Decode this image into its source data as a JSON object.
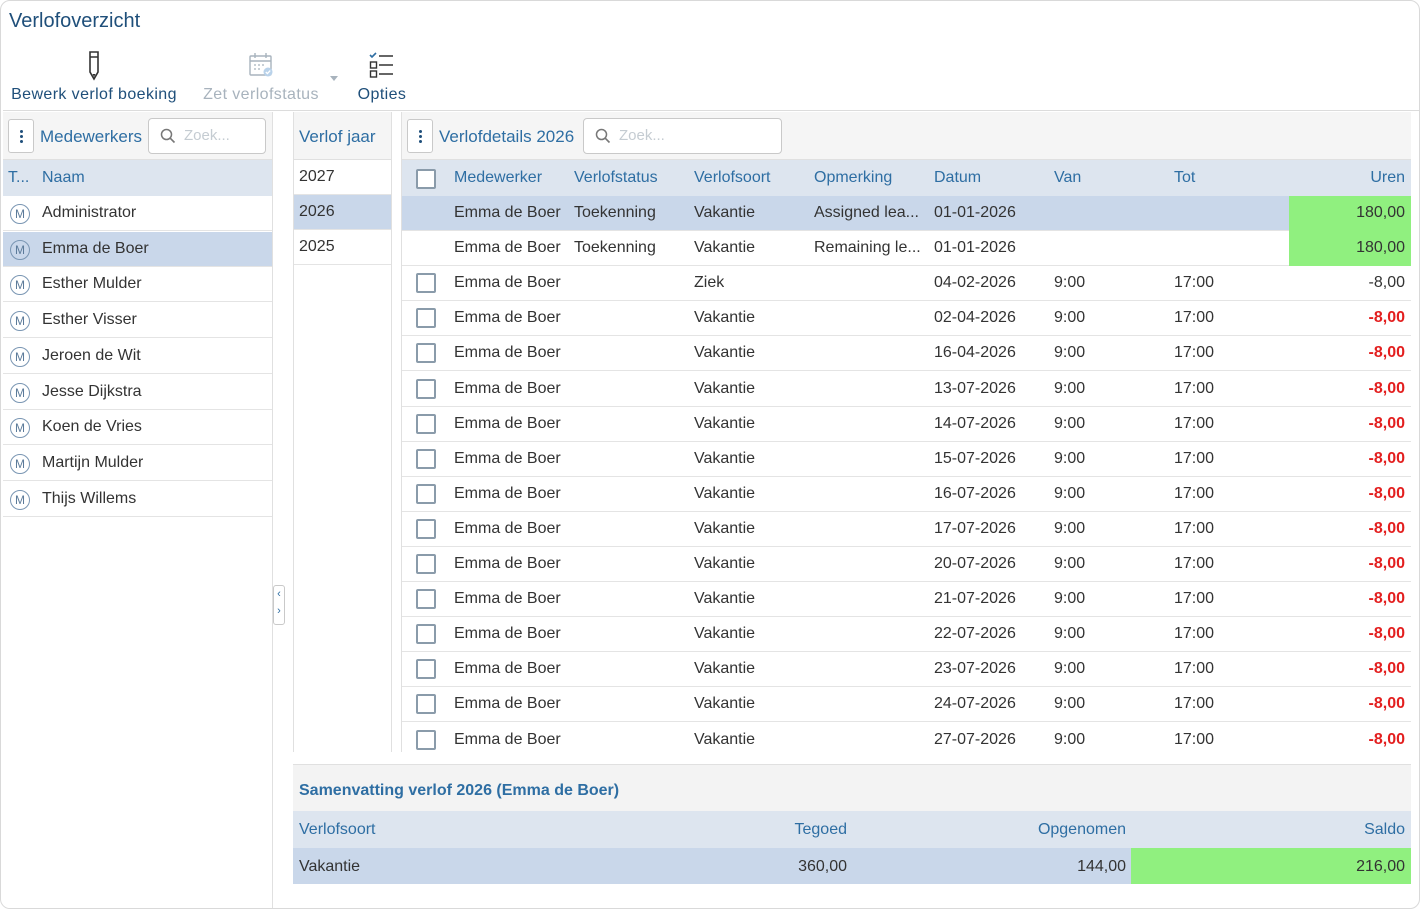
{
  "app": {
    "title": "Verlofoverzicht"
  },
  "toolbar": {
    "edit_label": "Bewerk verlof boeking",
    "status_label": "Zet verlofstatus",
    "options_label": "Opties"
  },
  "employees": {
    "title": "Medewerkers",
    "search_placeholder": "Zoek...",
    "col_type": "T...",
    "col_name": "Naam",
    "badge": "M",
    "items": [
      {
        "name": "Administrator"
      },
      {
        "name": "Emma de Boer",
        "selected": true
      },
      {
        "name": "Esther Mulder"
      },
      {
        "name": "Esther Visser"
      },
      {
        "name": "Jeroen de Wit"
      },
      {
        "name": "Jesse Dijkstra"
      },
      {
        "name": "Koen de Vries"
      },
      {
        "name": "Martijn Mulder"
      },
      {
        "name": "Thijs Willems"
      }
    ]
  },
  "years": {
    "title": "Verlof jaar",
    "items": [
      {
        "year": "2027"
      },
      {
        "year": "2026",
        "selected": true
      },
      {
        "year": "2025"
      }
    ]
  },
  "details": {
    "title": "Verlofdetails 2026",
    "search_placeholder": "Zoek...",
    "columns": {
      "medewerker": "Medewerker",
      "status": "Verlofstatus",
      "soort": "Verlofsoort",
      "opmerking": "Opmerking",
      "datum": "Datum",
      "van": "Van",
      "tot": "Tot",
      "uren": "Uren"
    },
    "rows": [
      {
        "medewerker": "Emma de Boer",
        "status": "Toekenning",
        "soort": "Vakantie",
        "opmerking": "Assigned lea...",
        "datum": "01-01-2026",
        "van": "",
        "tot": "",
        "uren": "180,00",
        "selected": true,
        "checkbox": false,
        "highlight": "green"
      },
      {
        "medewerker": "Emma de Boer",
        "status": "Toekenning",
        "soort": "Vakantie",
        "opmerking": "Remaining le...",
        "datum": "01-01-2026",
        "van": "",
        "tot": "",
        "uren": "180,00",
        "checkbox": false,
        "highlight": "green"
      },
      {
        "medewerker": "Emma de Boer",
        "status": "",
        "soort": "Ziek",
        "opmerking": "",
        "datum": "04-02-2026",
        "van": "9:00",
        "tot": "17:00",
        "uren": "-8,00",
        "checkbox": true,
        "highlight": "none"
      },
      {
        "medewerker": "Emma de Boer",
        "status": "",
        "soort": "Vakantie",
        "opmerking": "",
        "datum": "02-04-2026",
        "van": "9:00",
        "tot": "17:00",
        "uren": "-8,00",
        "checkbox": true,
        "highlight": "red"
      },
      {
        "medewerker": "Emma de Boer",
        "status": "",
        "soort": "Vakantie",
        "opmerking": "",
        "datum": "16-04-2026",
        "van": "9:00",
        "tot": "17:00",
        "uren": "-8,00",
        "checkbox": true,
        "highlight": "red"
      },
      {
        "medewerker": "Emma de Boer",
        "status": "",
        "soort": "Vakantie",
        "opmerking": "",
        "datum": "13-07-2026",
        "van": "9:00",
        "tot": "17:00",
        "uren": "-8,00",
        "checkbox": true,
        "highlight": "red"
      },
      {
        "medewerker": "Emma de Boer",
        "status": "",
        "soort": "Vakantie",
        "opmerking": "",
        "datum": "14-07-2026",
        "van": "9:00",
        "tot": "17:00",
        "uren": "-8,00",
        "checkbox": true,
        "highlight": "red"
      },
      {
        "medewerker": "Emma de Boer",
        "status": "",
        "soort": "Vakantie",
        "opmerking": "",
        "datum": "15-07-2026",
        "van": "9:00",
        "tot": "17:00",
        "uren": "-8,00",
        "checkbox": true,
        "highlight": "red"
      },
      {
        "medewerker": "Emma de Boer",
        "status": "",
        "soort": "Vakantie",
        "opmerking": "",
        "datum": "16-07-2026",
        "van": "9:00",
        "tot": "17:00",
        "uren": "-8,00",
        "checkbox": true,
        "highlight": "red"
      },
      {
        "medewerker": "Emma de Boer",
        "status": "",
        "soort": "Vakantie",
        "opmerking": "",
        "datum": "17-07-2026",
        "van": "9:00",
        "tot": "17:00",
        "uren": "-8,00",
        "checkbox": true,
        "highlight": "red"
      },
      {
        "medewerker": "Emma de Boer",
        "status": "",
        "soort": "Vakantie",
        "opmerking": "",
        "datum": "20-07-2026",
        "van": "9:00",
        "tot": "17:00",
        "uren": "-8,00",
        "checkbox": true,
        "highlight": "red"
      },
      {
        "medewerker": "Emma de Boer",
        "status": "",
        "soort": "Vakantie",
        "opmerking": "",
        "datum": "21-07-2026",
        "van": "9:00",
        "tot": "17:00",
        "uren": "-8,00",
        "checkbox": true,
        "highlight": "red"
      },
      {
        "medewerker": "Emma de Boer",
        "status": "",
        "soort": "Vakantie",
        "opmerking": "",
        "datum": "22-07-2026",
        "van": "9:00",
        "tot": "17:00",
        "uren": "-8,00",
        "checkbox": true,
        "highlight": "red"
      },
      {
        "medewerker": "Emma de Boer",
        "status": "",
        "soort": "Vakantie",
        "opmerking": "",
        "datum": "23-07-2026",
        "van": "9:00",
        "tot": "17:00",
        "uren": "-8,00",
        "checkbox": true,
        "highlight": "red"
      },
      {
        "medewerker": "Emma de Boer",
        "status": "",
        "soort": "Vakantie",
        "opmerking": "",
        "datum": "24-07-2026",
        "van": "9:00",
        "tot": "17:00",
        "uren": "-8,00",
        "checkbox": true,
        "highlight": "red"
      },
      {
        "medewerker": "Emma de Boer",
        "status": "",
        "soort": "Vakantie",
        "opmerking": "",
        "datum": "27-07-2026",
        "van": "9:00",
        "tot": "17:00",
        "uren": "-8,00",
        "checkbox": true,
        "highlight": "red"
      }
    ]
  },
  "summary": {
    "title": "Samenvatting verlof 2026 (Emma de Boer)",
    "columns": {
      "soort": "Verlofsoort",
      "tegoed": "Tegoed",
      "opgenomen": "Opgenomen",
      "saldo": "Saldo"
    },
    "row": {
      "soort": "Vakantie",
      "tegoed": "360,00",
      "opgenomen": "144,00",
      "saldo": "216,00"
    }
  },
  "colors": {
    "accent": "#2e6ea3",
    "selected_row": "#c9d7ea",
    "header_bg": "#dde5ef",
    "positive_green": "#90f07f",
    "negative_red": "#e31e1e"
  }
}
